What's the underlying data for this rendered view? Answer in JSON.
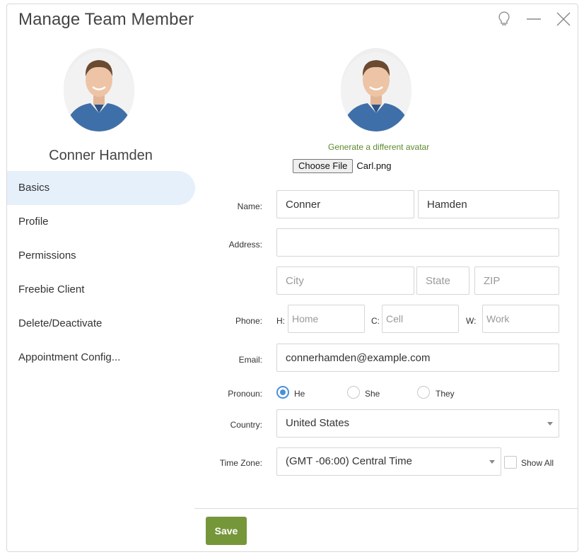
{
  "window": {
    "title": "Manage Team Member"
  },
  "sidebar": {
    "member_name": "Conner Hamden",
    "items": [
      {
        "label": "Basics",
        "active": true
      },
      {
        "label": "Profile"
      },
      {
        "label": "Permissions"
      },
      {
        "label": "Freebie Client"
      },
      {
        "label": "Delete/Deactivate"
      },
      {
        "label": "Appointment Config..."
      }
    ]
  },
  "avatar_section": {
    "generate_link": "Generate a different avatar",
    "choose_file_label": "Choose File",
    "file_name": "Carl.png"
  },
  "form": {
    "name_label": "Name:",
    "first_name": "Conner",
    "last_name": "Hamden",
    "address_label": "Address:",
    "address": "",
    "city_placeholder": "City",
    "state_placeholder": "State",
    "zip_placeholder": "ZIP",
    "phone_label": "Phone:",
    "home_prefix": "H:",
    "home_placeholder": "Home",
    "cell_prefix": "C:",
    "cell_placeholder": "Cell",
    "work_prefix": "W:",
    "work_placeholder": "Work",
    "email_label": "Email:",
    "email": "connerhamden@example.com",
    "pronoun_label": "Pronoun:",
    "pronouns": [
      {
        "label": "He",
        "checked": true
      },
      {
        "label": "She",
        "checked": false
      },
      {
        "label": "They",
        "checked": false
      }
    ],
    "country_label": "Country:",
    "country": "United States",
    "timezone_label": "Time Zone:",
    "timezone": "(GMT -06:00) Central Time",
    "show_all_label": "Show All"
  },
  "footer": {
    "save_label": "Save"
  },
  "colors": {
    "accent_green": "#76963a",
    "link_green": "#5e8a2e",
    "active_nav_bg": "#e6f0fa",
    "radio_blue": "#4a90d9"
  }
}
